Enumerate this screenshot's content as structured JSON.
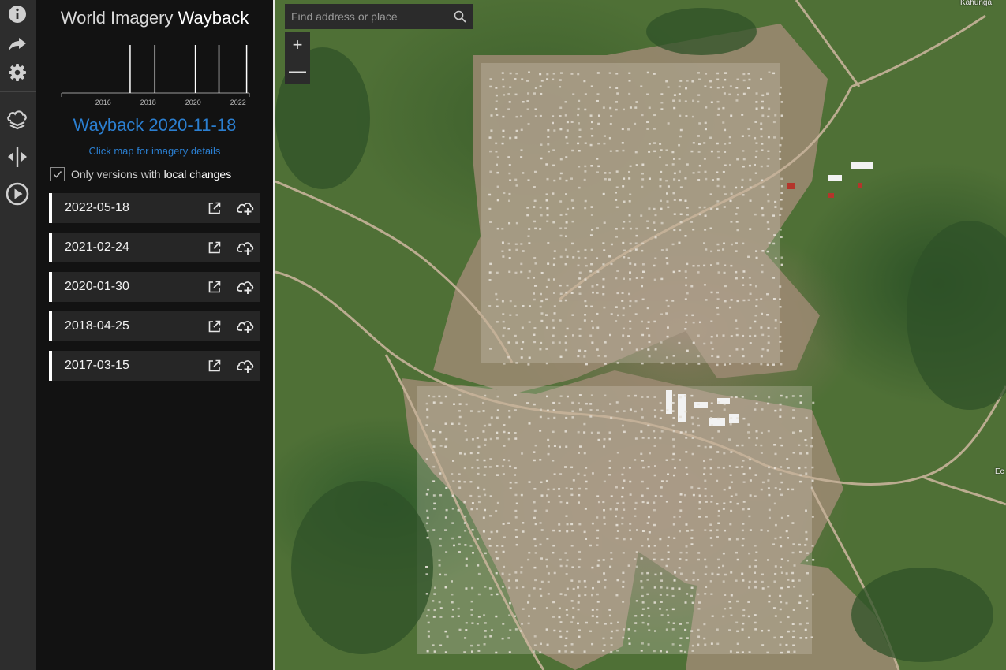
{
  "app": {
    "title_regular": "World Imagery",
    "title_bold": "Wayback"
  },
  "rail": {
    "icons": [
      "info-icon",
      "share-icon",
      "gear-icon",
      "layers-cloud-icon",
      "swipe-icon",
      "play-icon"
    ]
  },
  "timeline": {
    "tick_labels": [
      "2016",
      "2018",
      "2020",
      "2022"
    ],
    "release_years": [
      2017.2,
      2018.3,
      2020.1,
      2021.15,
      2022.38
    ]
  },
  "selected": {
    "label": "Wayback 2020-11-18",
    "hint": "Click map for imagery details"
  },
  "filter": {
    "label_regular": "Only versions with",
    "label_bold": "local changes",
    "checked": true
  },
  "releases": [
    {
      "date": "2022-05-18"
    },
    {
      "date": "2021-02-24"
    },
    {
      "date": "2020-01-30"
    },
    {
      "date": "2018-04-25"
    },
    {
      "date": "2017-03-15"
    }
  ],
  "search": {
    "placeholder": "Find address or place"
  },
  "zoom": {
    "in": "+",
    "out": "—"
  },
  "places": {
    "top_right": "Kahunga",
    "right_edge": "Ec"
  },
  "colors": {
    "accent": "#2b7fd1",
    "panel_bg": "#121212",
    "rail_bg": "#2d2d2d",
    "item_bg": "#262626"
  }
}
